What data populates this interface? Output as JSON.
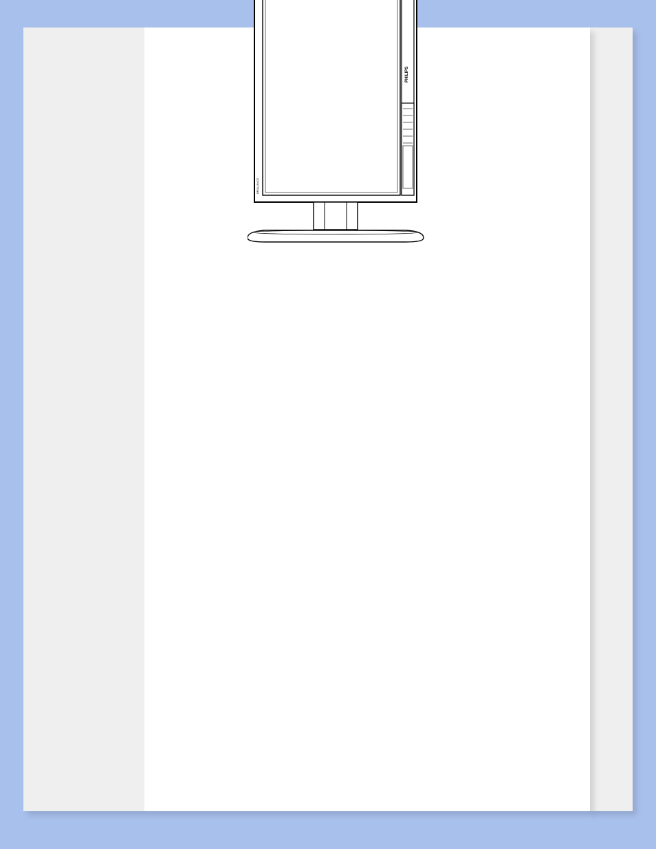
{
  "monitor": {
    "brand_label": "PHILIPS",
    "model_label": "BRILLIANCE"
  }
}
